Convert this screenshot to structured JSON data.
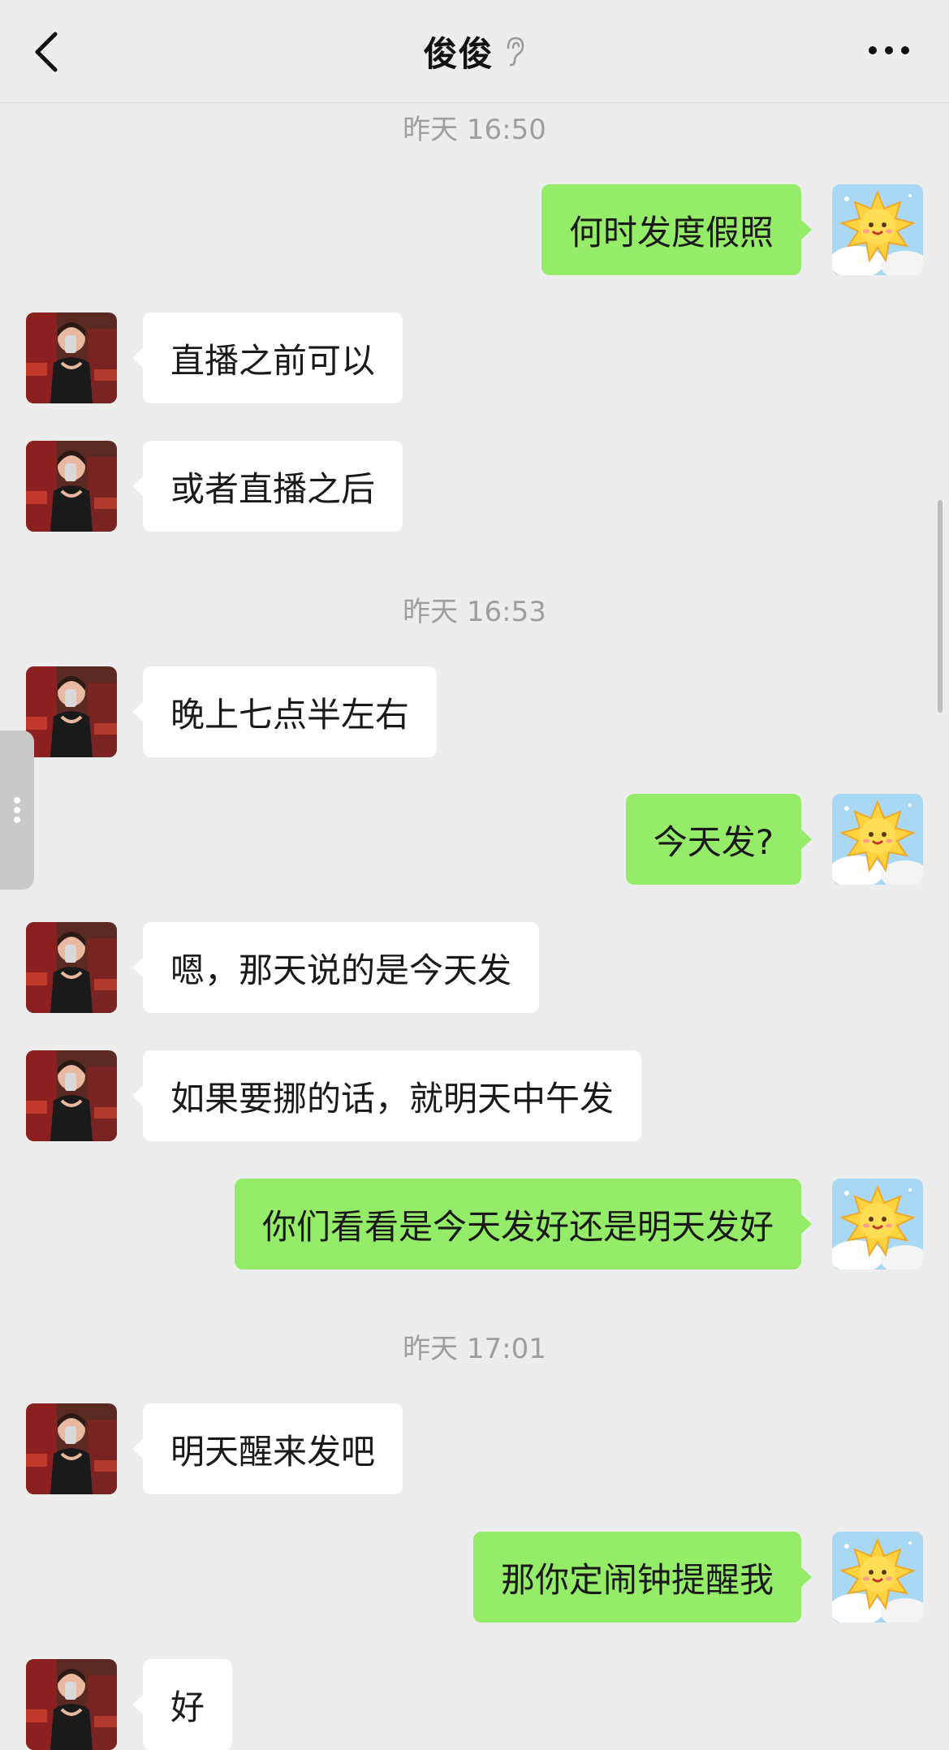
{
  "header": {
    "title": "俊俊",
    "back_icon": "chevron-left-icon",
    "ear_icon": "ear-icon",
    "more_icon": "more-dots-icon"
  },
  "colors": {
    "background": "#ededed",
    "incoming_bubble": "#ffffff",
    "outgoing_bubble": "#95ec69",
    "timestamp_text": "#9e9e9e"
  },
  "timestamps": [
    "昨天 16:50",
    "昨天 16:53",
    "昨天 17:01"
  ],
  "messages": [
    {
      "from": "me",
      "text": "何时发度假照"
    },
    {
      "from": "contact",
      "text": "直播之前可以"
    },
    {
      "from": "contact",
      "text": "或者直播之后"
    },
    {
      "from": "contact",
      "text": "晚上七点半左右"
    },
    {
      "from": "me",
      "text": "今天发?"
    },
    {
      "from": "contact",
      "text": "嗯，那天说的是今天发"
    },
    {
      "from": "contact",
      "text": "如果要挪的话，就明天中午发"
    },
    {
      "from": "me",
      "text": "你们看看是今天发好还是明天发好"
    },
    {
      "from": "contact",
      "text": "明天醒来发吧"
    },
    {
      "from": "me",
      "text": "那你定闹钟提醒我"
    },
    {
      "from": "contact",
      "text": "好"
    }
  ]
}
